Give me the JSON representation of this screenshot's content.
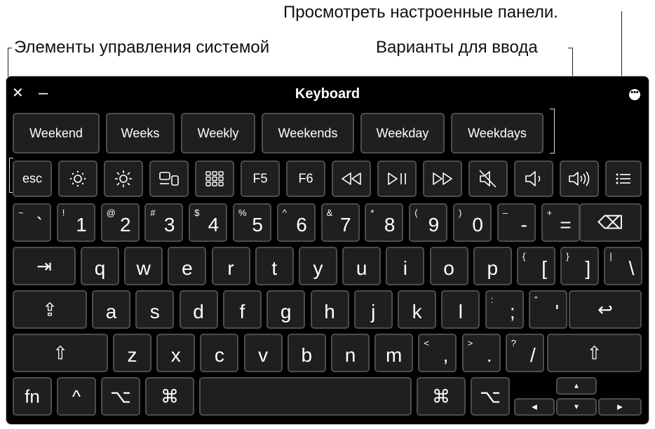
{
  "callouts": {
    "system_controls": "Элементы управления системой",
    "typing_suggestions": "Варианты для ввода",
    "custom_panels": "Просмотреть настроенные панели."
  },
  "window": {
    "title": "Keyboard",
    "close": "✕",
    "minimize": "–",
    "more": "•••"
  },
  "suggestions": [
    "Weekend",
    "Weeks",
    "Weekly",
    "Weekends",
    "Weekday",
    "Weekdays"
  ],
  "function_row": {
    "esc": "esc",
    "f5": "F5",
    "f6": "F6"
  },
  "number_row": [
    {
      "main": "`",
      "sub": "~"
    },
    {
      "main": "1",
      "sub": "!"
    },
    {
      "main": "2",
      "sub": "@"
    },
    {
      "main": "3",
      "sub": "#"
    },
    {
      "main": "4",
      "sub": "$"
    },
    {
      "main": "5",
      "sub": "%"
    },
    {
      "main": "6",
      "sub": "^"
    },
    {
      "main": "7",
      "sub": "&"
    },
    {
      "main": "8",
      "sub": "*"
    },
    {
      "main": "9",
      "sub": "("
    },
    {
      "main": "0",
      "sub": ")"
    },
    {
      "main": "-",
      "sub": "–"
    },
    {
      "main": "=",
      "sub": "+"
    }
  ],
  "row_q": [
    {
      "main": "q"
    },
    {
      "main": "w"
    },
    {
      "main": "e"
    },
    {
      "main": "r"
    },
    {
      "main": "t"
    },
    {
      "main": "y"
    },
    {
      "main": "u"
    },
    {
      "main": "i"
    },
    {
      "main": "o"
    },
    {
      "main": "p"
    },
    {
      "main": "[",
      "sub": "{"
    },
    {
      "main": "]",
      "sub": "}"
    },
    {
      "main": "\\",
      "sub": "|"
    }
  ],
  "row_a": [
    {
      "main": "a"
    },
    {
      "main": "s"
    },
    {
      "main": "d"
    },
    {
      "main": "f"
    },
    {
      "main": "g"
    },
    {
      "main": "h"
    },
    {
      "main": "j"
    },
    {
      "main": "k"
    },
    {
      "main": "l"
    },
    {
      "main": ";",
      "sub": ":"
    },
    {
      "main": "'",
      "sub": "\""
    }
  ],
  "row_z": [
    {
      "main": "z"
    },
    {
      "main": "x"
    },
    {
      "main": "c"
    },
    {
      "main": "v"
    },
    {
      "main": "b"
    },
    {
      "main": "n"
    },
    {
      "main": "m"
    },
    {
      "main": ",",
      "sub": "<"
    },
    {
      "main": ".",
      "sub": ">"
    },
    {
      "main": "/",
      "sub": "?"
    }
  ],
  "bottom_row": {
    "fn": "fn",
    "control": "^",
    "option": "⌥",
    "command": "⌘",
    "arrow_up": "▲",
    "arrow_left": "◀",
    "arrow_down": "▼",
    "arrow_right": "▶"
  },
  "special_keys": {
    "tab": "⇥",
    "caps": "⇪",
    "shift": "⇧",
    "return": "↩",
    "delete": "⌫"
  }
}
